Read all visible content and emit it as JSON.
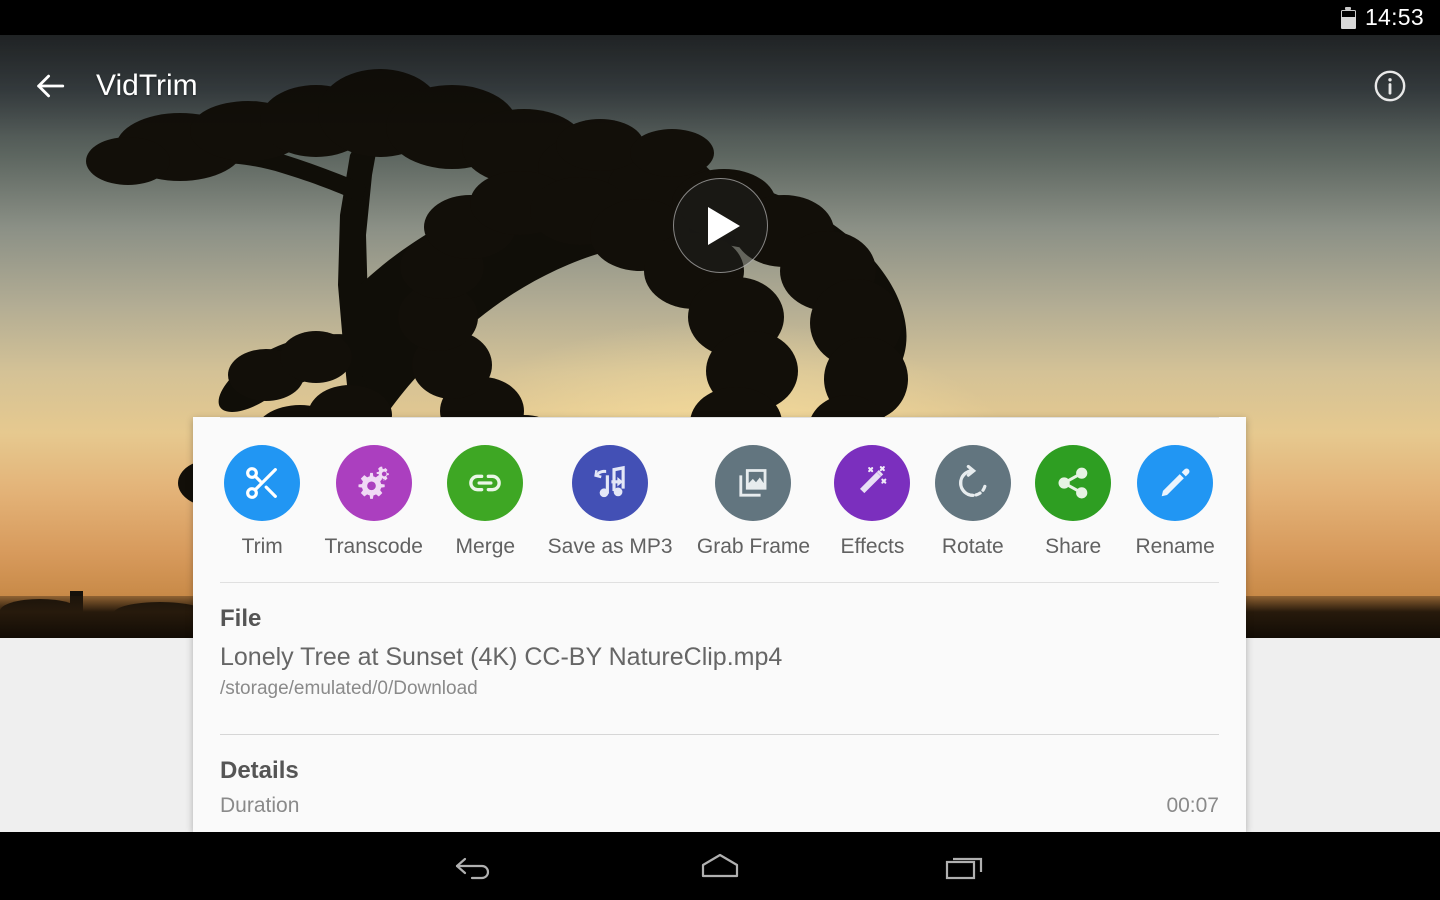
{
  "statusbar": {
    "time": "14:53",
    "battery_icon": "battery-half-icon"
  },
  "appbar": {
    "title": "VidTrim",
    "back_icon": "arrow-back-icon",
    "info_icon": "info-icon"
  },
  "video": {
    "play_icon": "play-icon",
    "description": "Lonely tree silhouette at sunset"
  },
  "actions": [
    {
      "label": "Trim",
      "icon": "scissors-icon",
      "color": "#2196f3"
    },
    {
      "label": "Transcode",
      "icon": "gears-icon",
      "color": "#ab3fbf"
    },
    {
      "label": "Merge",
      "icon": "link-icon",
      "color": "#3ea724"
    },
    {
      "label": "Save as MP3",
      "icon": "music-note-export-icon",
      "color": "#4350b5"
    },
    {
      "label": "Grab Frame",
      "icon": "photo-library-icon",
      "color": "#62757f"
    },
    {
      "label": "Effects",
      "icon": "magic-wand-icon",
      "color": "#7b2fbe"
    },
    {
      "label": "Rotate",
      "icon": "rotate-right-icon",
      "color": "#62757f"
    },
    {
      "label": "Share",
      "icon": "share-icon",
      "color": "#2e9e22"
    },
    {
      "label": "Rename",
      "icon": "pencil-icon",
      "color": "#2196f3"
    }
  ],
  "file": {
    "heading": "File",
    "name": "Lonely Tree at Sunset (4K) CC-BY NatureClip.mp4",
    "path": "/storage/emulated/0/Download"
  },
  "details": {
    "heading": "Details",
    "rows": [
      {
        "label": "Duration",
        "value": "00:07"
      }
    ]
  },
  "navbar": {
    "back_icon": "nav-back-icon",
    "home_icon": "nav-home-icon",
    "recents_icon": "nav-recents-icon"
  }
}
